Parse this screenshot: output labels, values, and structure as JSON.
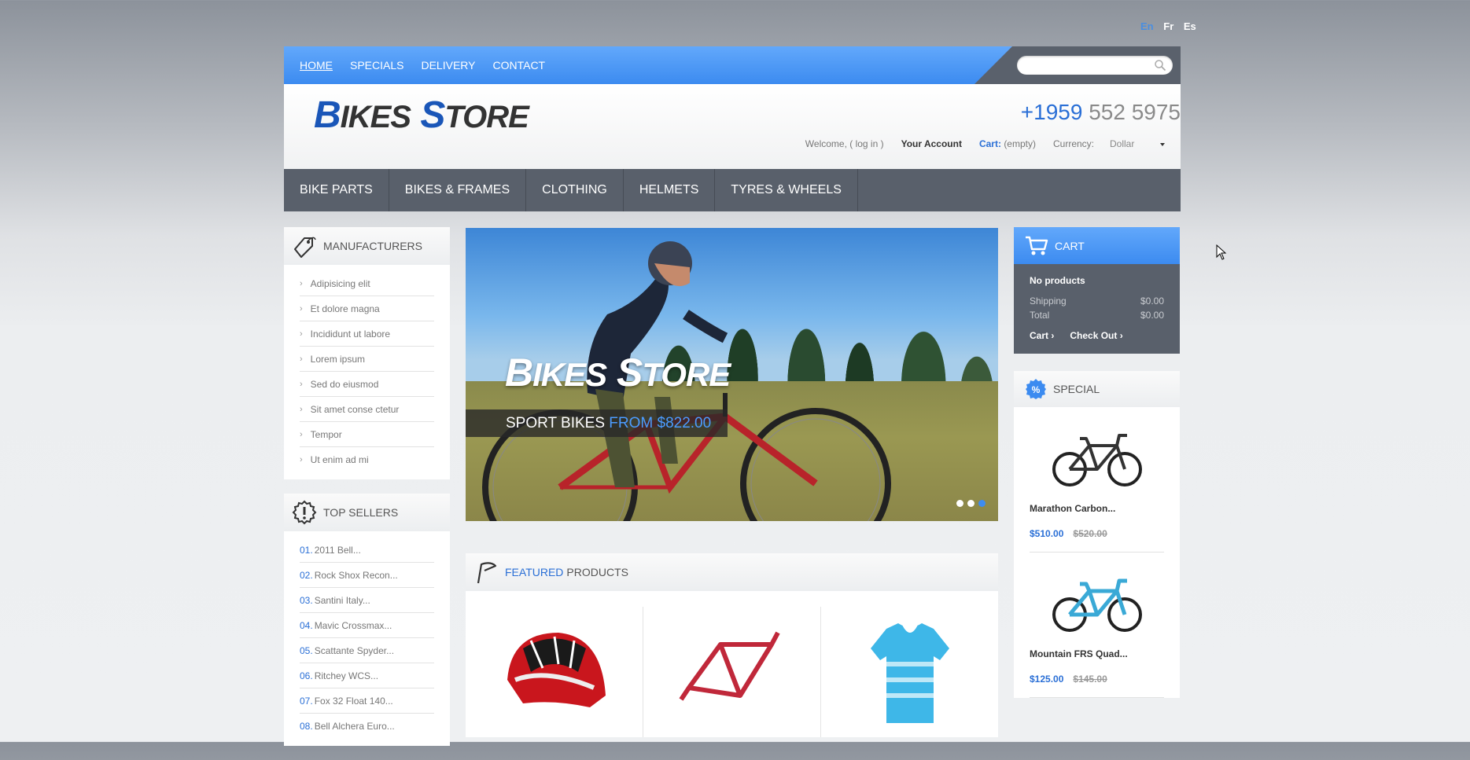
{
  "languages": [
    {
      "label": "En",
      "active": true
    },
    {
      "label": "Fr",
      "active": false
    },
    {
      "label": "Es",
      "active": false
    }
  ],
  "top_nav": [
    "HOME",
    "SPECIALS",
    "DELIVERY",
    "CONTACT"
  ],
  "search": {
    "placeholder": "",
    "icon": "search-icon"
  },
  "logo": {
    "part1_big": "B",
    "part1_small": "IKES",
    "part2_big": "S",
    "part2_small": "TORE"
  },
  "phone": {
    "code": "+1959",
    "number": "552 5975"
  },
  "user_bar": {
    "welcome": "Welcome, ( log in )",
    "account": "Your Account",
    "cart_label": "Cart:",
    "cart_value": "(empty)",
    "currency_label": "Currency:",
    "currency_value": "Dollar"
  },
  "categories": [
    "BIKE PARTS",
    "BIKES & FRAMES",
    "CLOTHING",
    "HELMETS",
    "TYRES & WHEELS"
  ],
  "manufacturers": {
    "title": "MANUFACTURERS",
    "items": [
      "Adipisicing elit",
      "Et dolore magna",
      "Incididunt ut labore",
      "Lorem ipsum",
      "Sed do eiusmod",
      "Sit amet conse ctetur",
      "Tempor",
      "Ut enim ad mi"
    ]
  },
  "top_sellers": {
    "title": "TOP SELLERS",
    "items": [
      {
        "num": "01.",
        "name": "2011 Bell..."
      },
      {
        "num": "02.",
        "name": "Rock Shox Recon..."
      },
      {
        "num": "03.",
        "name": "Santini Italy..."
      },
      {
        "num": "04.",
        "name": "Mavic Crossmax..."
      },
      {
        "num": "05.",
        "name": "Scattante Spyder..."
      },
      {
        "num": "06.",
        "name": "Ritchey WCS..."
      },
      {
        "num": "07.",
        "name": "Fox 32 Float 140..."
      },
      {
        "num": "08.",
        "name": "Bell Alchera Euro..."
      }
    ]
  },
  "slider": {
    "title_big1": "B",
    "title_small1": "IKES",
    "title_big2": "S",
    "title_small2": "TORE",
    "caption": "SPORT BIKES",
    "price": "FROM $822.00",
    "active_slide": 3,
    "slide_count": 3
  },
  "featured": {
    "title_highlight": "FEATURED",
    "title_rest": "PRODUCTS"
  },
  "cart": {
    "title": "CART",
    "no_products": "No products",
    "shipping_label": "Shipping",
    "shipping_value": "$0.00",
    "total_label": "Total",
    "total_value": "$0.00",
    "cart_link": "Cart",
    "checkout_link": "Check Out"
  },
  "special": {
    "title": "SPECIAL",
    "products": [
      {
        "name": "Marathon Carbon...",
        "price": "$510.00",
        "old_price": "$520.00",
        "bike_color": "#333333"
      },
      {
        "name": "Mountain FRS Quad...",
        "price": "$125.00",
        "old_price": "$145.00",
        "bike_color": "#3aa9d6"
      }
    ]
  },
  "colors": {
    "accent": "#3c8bf0",
    "dark": "#59606b",
    "link_blue": "#2a6fd6"
  }
}
